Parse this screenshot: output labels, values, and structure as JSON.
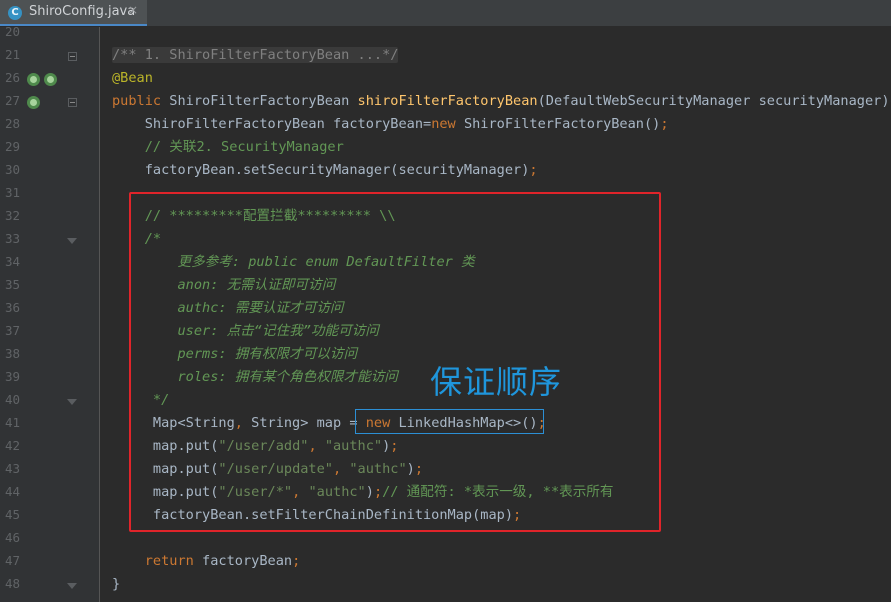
{
  "tab": {
    "title": "ShiroConfig.java",
    "icon": "java-class-icon",
    "close": "×"
  },
  "overlay_label": "保证顺序",
  "lines": [
    {
      "n": "20",
      "segs": []
    },
    {
      "n": "21",
      "segs": [
        {
          "c": "lcom collapsed",
          "t": "/** 1. ShiroFilterFactoryBean ...*/"
        }
      ]
    },
    {
      "n": "26",
      "segs": [
        {
          "c": "ann",
          "t": "@Bean"
        }
      ]
    },
    {
      "n": "27",
      "segs": [
        {
          "c": "kw",
          "t": "public "
        },
        {
          "c": "txt",
          "t": "ShiroFilterFactoryBean "
        },
        {
          "c": "fn",
          "t": "shiroFilterFactoryBean"
        },
        {
          "c": "txt",
          "t": "(DefaultWebSecurityManager securityManager){"
        }
      ]
    },
    {
      "n": "28",
      "segs": [
        {
          "c": "txt",
          "t": "    ShiroFilterFactoryBean factoryBean="
        },
        {
          "c": "kw",
          "t": "new "
        },
        {
          "c": "txt",
          "t": "ShiroFilterFactoryBean()"
        },
        {
          "c": "kw",
          "t": ";"
        }
      ]
    },
    {
      "n": "29",
      "segs": [
        {
          "c": "com",
          "t": "    // 关联2. SecurityManager"
        }
      ]
    },
    {
      "n": "30",
      "segs": [
        {
          "c": "txt",
          "t": "    factoryBean.setSecurityManager(securityManager)"
        },
        {
          "c": "kw",
          "t": ";"
        }
      ]
    },
    {
      "n": "31",
      "segs": []
    },
    {
      "n": "32",
      "segs": [
        {
          "c": "com",
          "t": "    // *********配置拦截********* \\\\"
        }
      ]
    },
    {
      "n": "33",
      "segs": [
        {
          "c": "doc",
          "t": "    /*"
        }
      ]
    },
    {
      "n": "34",
      "segs": [
        {
          "c": "doc",
          "t": "        更多参考: public enum DefaultFilter 类"
        }
      ]
    },
    {
      "n": "35",
      "segs": [
        {
          "c": "doc",
          "t": "        anon: 无需认证即可访问"
        }
      ]
    },
    {
      "n": "36",
      "segs": [
        {
          "c": "doc",
          "t": "        authc: 需要认证才可访问"
        }
      ]
    },
    {
      "n": "37",
      "segs": [
        {
          "c": "doc",
          "t": "        user: 点击“记住我”功能可访问"
        }
      ]
    },
    {
      "n": "38",
      "segs": [
        {
          "c": "doc",
          "t": "        perms: 拥有权限才可以访问"
        }
      ]
    },
    {
      "n": "39",
      "segs": [
        {
          "c": "doc",
          "t": "        roles: 拥有某个角色权限才能访问"
        }
      ]
    },
    {
      "n": "40",
      "segs": [
        {
          "c": "doc",
          "t": "     */"
        }
      ]
    },
    {
      "n": "41",
      "segs": [
        {
          "c": "txt",
          "t": "     Map<String"
        },
        {
          "c": "kw",
          "t": ", "
        },
        {
          "c": "txt",
          "t": "String> map = "
        },
        {
          "c": "kw",
          "t": "new "
        },
        {
          "c": "txt",
          "t": "LinkedHashMap<>()"
        },
        {
          "c": "kw",
          "t": ";"
        }
      ]
    },
    {
      "n": "42",
      "segs": [
        {
          "c": "txt",
          "t": "     map.put("
        },
        {
          "c": "str",
          "t": "\"/user/add\""
        },
        {
          "c": "kw",
          "t": ", "
        },
        {
          "c": "str",
          "t": "\"authc\""
        },
        {
          "c": "txt",
          "t": ")"
        },
        {
          "c": "kw",
          "t": ";"
        }
      ]
    },
    {
      "n": "43",
      "segs": [
        {
          "c": "txt",
          "t": "     map.put("
        },
        {
          "c": "str",
          "t": "\"/user/update\""
        },
        {
          "c": "kw",
          "t": ", "
        },
        {
          "c": "str",
          "t": "\"authc\""
        },
        {
          "c": "txt",
          "t": ")"
        },
        {
          "c": "kw",
          "t": ";"
        }
      ]
    },
    {
      "n": "44",
      "segs": [
        {
          "c": "txt",
          "t": "     map.put("
        },
        {
          "c": "str",
          "t": "\"/user/*\""
        },
        {
          "c": "kw",
          "t": ", "
        },
        {
          "c": "str",
          "t": "\"authc\""
        },
        {
          "c": "txt",
          "t": ")"
        },
        {
          "c": "kw",
          "t": ";"
        },
        {
          "c": "com",
          "t": "// 通配符: *表示一级, **表示所有"
        }
      ]
    },
    {
      "n": "45",
      "segs": [
        {
          "c": "txt",
          "t": "     factoryBean.setFilterChainDefinitionMap(map)"
        },
        {
          "c": "kw",
          "t": ";"
        }
      ]
    },
    {
      "n": "46",
      "segs": []
    },
    {
      "n": "47",
      "segs": [
        {
          "c": "kw",
          "t": "    return "
        },
        {
          "c": "txt",
          "t": "factoryBean"
        },
        {
          "c": "kw",
          "t": ";"
        }
      ]
    },
    {
      "n": "48",
      "segs": [
        {
          "c": "txt",
          "t": "}"
        }
      ]
    }
  ],
  "gutter_icons": [
    {
      "line": "26",
      "names": [
        "bean-navigation-icon",
        "override-marker-icon"
      ]
    },
    {
      "line": "27",
      "names": [
        "implemented-method-icon"
      ]
    }
  ]
}
